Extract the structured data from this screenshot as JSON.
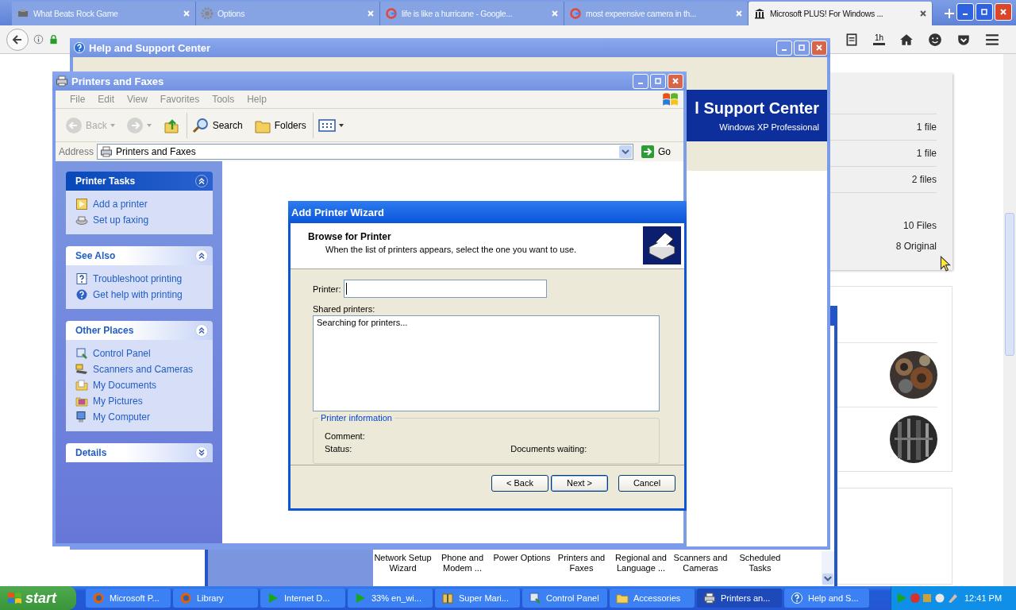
{
  "browser": {
    "tabs": [
      {
        "label": "What Beats Rock Game",
        "selected": false
      },
      {
        "label": "Options",
        "selected": false
      },
      {
        "label": "life is like a hurricane - Google...",
        "selected": false
      },
      {
        "label": "most expeensive camera in th...",
        "selected": false
      },
      {
        "label": "Microsoft PLUS! For Windows ...",
        "selected": true
      }
    ],
    "history_badge": "1h"
  },
  "web_page": {
    "file_counts": [
      "1 file",
      "1 file",
      "2 files",
      "10 Files",
      "8 Original"
    ]
  },
  "control_panel": {
    "items": [
      "Network Setup Wizard",
      "Phone and Modem ...",
      "Power Options",
      "Printers and Faxes",
      "Regional and Language ...",
      "Scanners and Cameras",
      "Scheduled Tasks"
    ]
  },
  "help_window": {
    "title": "Help and Support Center",
    "banner_title": "l Support Center",
    "banner_subtitle": "Windows XP Professional"
  },
  "printers_window": {
    "title": "Printers and Faxes",
    "menu": [
      "File",
      "Edit",
      "View",
      "Favorites",
      "Tools",
      "Help"
    ],
    "toolbar": [
      {
        "kind": "back",
        "label": "Back",
        "disabled": true
      },
      {
        "kind": "forward",
        "disabled": true
      },
      {
        "kind": "up",
        "disabled": false
      },
      {
        "kind": "search",
        "label": "Search",
        "disabled": false
      },
      {
        "kind": "folders",
        "label": "Folders",
        "disabled": false
      },
      {
        "kind": "views",
        "disabled": false
      }
    ],
    "address_label": "Address",
    "address": "Printers and Faxes",
    "go": "Go",
    "panels": [
      {
        "title": "Printer Tasks",
        "kind": "special",
        "expanded": true,
        "items": [
          "Add a printer",
          "Set up faxing"
        ]
      },
      {
        "title": "See Also",
        "kind": "normal",
        "expanded": true,
        "items": [
          "Troubleshoot printing",
          "Get help with printing"
        ]
      },
      {
        "title": "Other Places",
        "kind": "normal",
        "expanded": true,
        "items": [
          "Control Panel",
          "Scanners and Cameras",
          "My Documents",
          "My Pictures",
          "My Computer"
        ]
      },
      {
        "title": "Details",
        "kind": "normal",
        "expanded": false
      }
    ]
  },
  "wizard": {
    "title": "Add Printer Wizard",
    "heading": "Browse for Printer",
    "subheading": "When the list of printers appears, select the one you want to use.",
    "printer_label": "Printer:",
    "shared_label": "Shared printers:",
    "shared_list": [
      "Searching for printers..."
    ],
    "info_title": "Printer information",
    "comment_label": "Comment:",
    "status_label": "Status:",
    "documents_label": "Documents waiting:",
    "buttons": [
      {
        "label": "< Back",
        "kind": "normal"
      },
      {
        "label": "Next >",
        "kind": "default"
      },
      {
        "label": "Cancel",
        "kind": "normal"
      }
    ]
  },
  "taskbar": {
    "start": "start",
    "items": [
      {
        "label": "Microsoft P...",
        "selected": false
      },
      {
        "label": "Library",
        "selected": false
      },
      {
        "label": "Internet D...",
        "selected": false
      },
      {
        "label": "33% en_wi...",
        "selected": false
      },
      {
        "label": "Super Mari...",
        "selected": false
      },
      {
        "label": "Control Panel",
        "selected": false
      },
      {
        "label": "Accessories",
        "selected": false
      },
      {
        "label": "Printers an...",
        "selected": true
      },
      {
        "label": "Help and S...",
        "selected": false
      }
    ],
    "clock": "12:41 PM"
  }
}
